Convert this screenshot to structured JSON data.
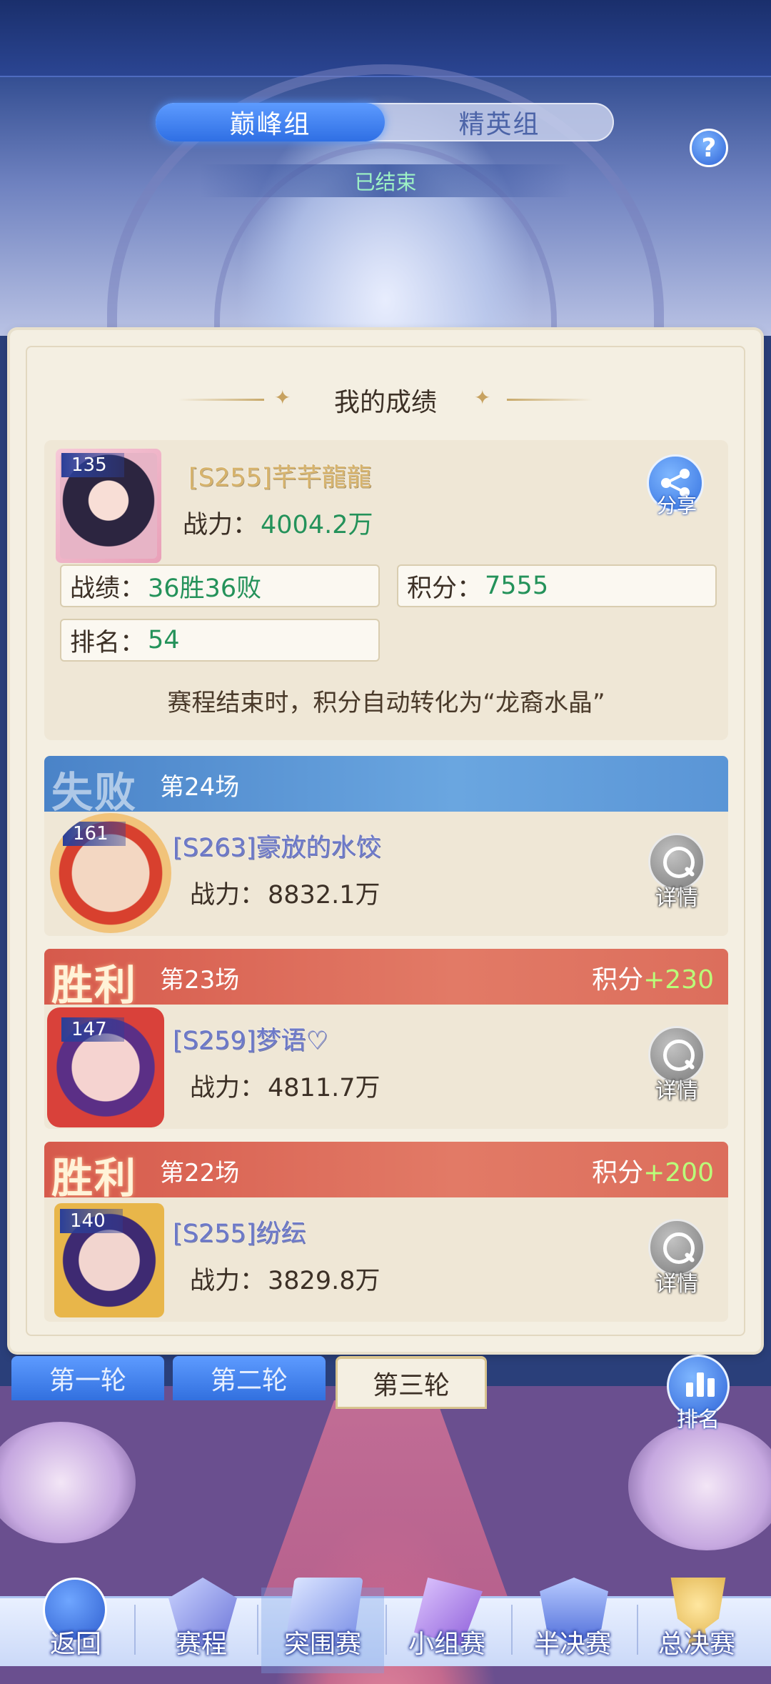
{
  "group_tabs": {
    "active": "巅峰组",
    "inactive": "精英组"
  },
  "status": "已结束",
  "help_label": "?",
  "section_title": "我的成绩",
  "me": {
    "level": "135",
    "name": "[S255]芊芊龍龍",
    "power_label": "战力：",
    "power_value": "4004.2万",
    "share_label": "分享",
    "record_label": "战绩：",
    "record_value": "36胜36败",
    "score_label": "积分：",
    "score_value": "7555",
    "rank_label": "排名：",
    "rank_value": "54",
    "note": "赛程结束时，积分自动转化为“龙裔水晶”"
  },
  "matches": [
    {
      "result": "失败",
      "match_no": "第24场",
      "score_label": "",
      "score_value": "",
      "level": "161",
      "name": "[S263]豪放的水饺",
      "power_label": "战力：",
      "power_value": "8832.1万",
      "detail_label": "详情"
    },
    {
      "result": "胜利",
      "match_no": "第23场",
      "score_label": "积分",
      "score_value": "+230",
      "level": "147",
      "name": "[S259]梦语♡",
      "power_label": "战力：",
      "power_value": "4811.7万",
      "detail_label": "详情"
    },
    {
      "result": "胜利",
      "match_no": "第22场",
      "score_label": "积分",
      "score_value": "+200",
      "level": "140",
      "name": "[S255]纷纭",
      "power_label": "战力：",
      "power_value": "3829.8万",
      "detail_label": "详情"
    }
  ],
  "round_tabs": [
    "第一轮",
    "第二轮",
    "第三轮"
  ],
  "rank_button_label": "排名",
  "bottom_nav": [
    "返回",
    "赛程",
    "突围赛",
    "小组赛",
    "半决赛",
    "总决赛"
  ],
  "colors": {
    "win": "#d65a4c",
    "lose": "#4a83c8",
    "accent_green": "#24925a",
    "primary_blue": "#2f6fe4"
  }
}
